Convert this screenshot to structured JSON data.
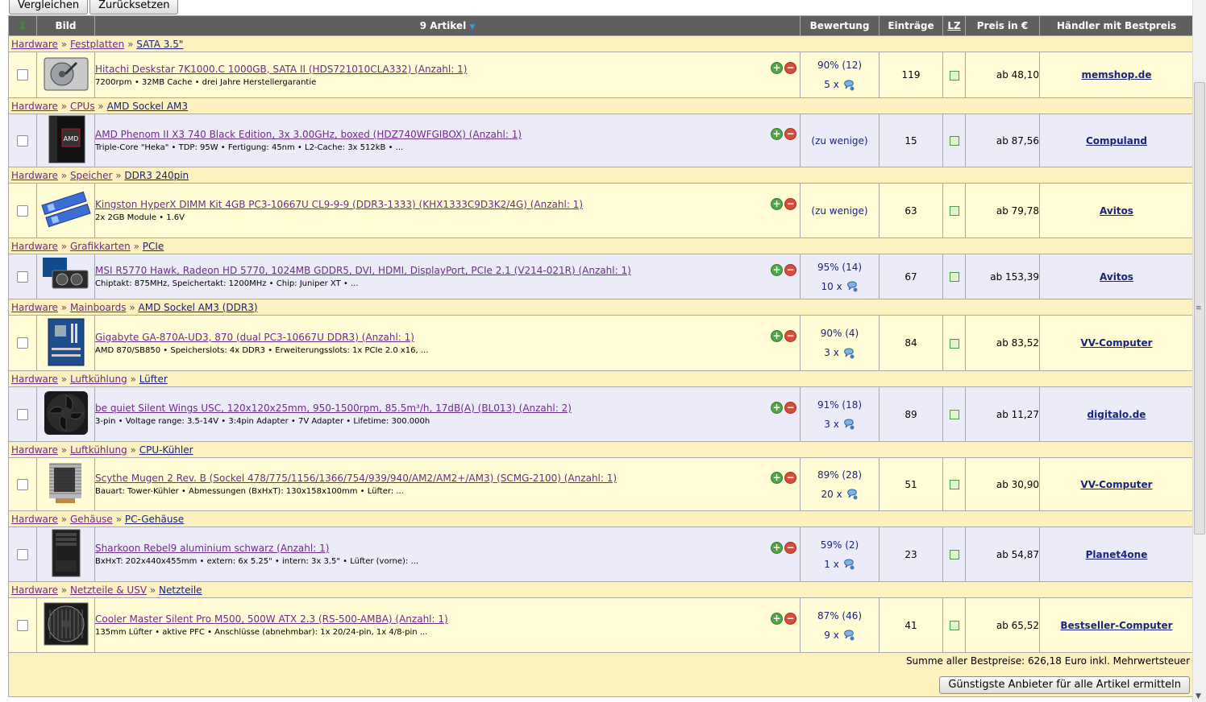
{
  "toolbar": {
    "compare_label": "Vergleichen",
    "reset_label": "Zurücksetzen"
  },
  "header": {
    "sort_icon": "arrow-down-icon",
    "image": "Bild",
    "count": "9 Artikel",
    "rating": "Bewertung",
    "entries": "Einträge",
    "lz": "LZ",
    "price": "Preis in €",
    "dealer": "Händler mit Bestpreis"
  },
  "items": [
    {
      "breadcrumb": [
        "Hardware",
        "Festplatten",
        "SATA 3.5\""
      ],
      "title": "Hitachi Deskstar 7K1000.C 1000GB, SATA II (HDS721010CLA332) (Anzahl: 1)",
      "sub": "7200rpm • 32MB Cache • drei Jahre Herstellergarantie",
      "rating": "90% (12)",
      "comments": "5 x",
      "entries": "119",
      "price": "ab 48,10",
      "dealer": "memshop.de",
      "icon": "hard-drive-icon"
    },
    {
      "breadcrumb": [
        "Hardware",
        "CPUs",
        "AMD Sockel AM3"
      ],
      "title": "AMD Phenom II X3 740 Black Edition, 3x 3.00GHz, boxed (HDZ740WFGIBOX) (Anzahl: 1)",
      "sub": "Triple-Core \"Heka\" • TDP: 95W • Fertigung: 45nm • L2-Cache: 3x 512kB • ...",
      "rating": "(zu wenige)",
      "comments": "",
      "entries": "15",
      "price": "ab 87,56",
      "dealer": "Compuland",
      "icon": "cpu-box-icon"
    },
    {
      "breadcrumb": [
        "Hardware",
        "Speicher",
        "DDR3 240pin"
      ],
      "title": "Kingston HyperX DIMM Kit 4GB PC3-10667U CL9-9-9 (DDR3-1333) (KHX1333C9D3K2/4G) (Anzahl: 1)",
      "sub": "2x 2GB Module • 1.6V",
      "rating": "(zu wenige)",
      "comments": "",
      "entries": "63",
      "price": "ab 79,78",
      "dealer": "Avitos",
      "icon": "ram-icon"
    },
    {
      "breadcrumb": [
        "Hardware",
        "Grafikkarten",
        "PCIe"
      ],
      "title": "MSI R5770 Hawk, Radeon HD 5770, 1024MB GDDR5, DVI, HDMI, DisplayPort, PCIe 2.1 (V214-021R) (Anzahl: 1)",
      "sub": "Chiptakt: 875MHz, Speichertakt: 1200MHz • Chip: Juniper XT • ...",
      "rating": "95% (14)",
      "comments": "10 x",
      "entries": "67",
      "price": "ab 153,39",
      "dealer": "Avitos",
      "icon": "graphics-card-icon"
    },
    {
      "breadcrumb": [
        "Hardware",
        "Mainboards",
        "AMD Sockel AM3 (DDR3)"
      ],
      "title": "Gigabyte GA-870A-UD3, 870 (dual PC3-10667U DDR3) (Anzahl: 1)",
      "sub": "AMD 870/SB850 • Speicherslots: 4x DDR3 • Erweiterungsslots: 1x PCIe 2.0 x16, ...",
      "rating": "90% (4)",
      "comments": "3 x",
      "entries": "84",
      "price": "ab 83,52",
      "dealer": "VV-Computer",
      "icon": "mainboard-icon"
    },
    {
      "breadcrumb": [
        "Hardware",
        "Luftkühlung",
        "Lüfter"
      ],
      "title": "be quiet Silent Wings USC, 120x120x25mm, 950-1500rpm, 85.5m³/h, 17dB(A) (BL013) (Anzahl: 2)",
      "sub": "3-pin • Voltage range: 3.5-14V • 3:4pin Adapter • 7V Adapter • Lifetime: 300.000h",
      "rating": "91% (18)",
      "comments": "3 x",
      "entries": "89",
      "price": "ab 11,27",
      "dealer": "digitalo.de",
      "icon": "fan-icon"
    },
    {
      "breadcrumb": [
        "Hardware",
        "Luftkühlung",
        "CPU-Kühler"
      ],
      "title": "Scythe Mugen 2 Rev. B (Sockel 478/775/1156/1366/754/939/940/AM2/AM2+/AM3) (SCMG-2100) (Anzahl: 1)",
      "sub": "Bauart: Tower-Kühler • Abmessungen (BxHxT): 130x158x100mm • Lüfter: ...",
      "rating": "89% (28)",
      "comments": "20 x",
      "entries": "51",
      "price": "ab 30,90",
      "dealer": "VV-Computer",
      "icon": "cpu-cooler-icon"
    },
    {
      "breadcrumb": [
        "Hardware",
        "Gehäuse",
        "PC-Gehäuse"
      ],
      "title": "Sharkoon Rebel9 aluminium schwarz (Anzahl: 1)",
      "sub": "BxHxT: 202x440x455mm • extern: 6x 5.25\" • intern: 3x 3.5\" • Lüfter (vorne): ...",
      "rating": "59% (2)",
      "comments": "1 x",
      "entries": "23",
      "price": "ab 54,87",
      "dealer": "Planet4one",
      "icon": "pc-case-icon"
    },
    {
      "breadcrumb": [
        "Hardware",
        "Netzteile & USV",
        "Netzteile"
      ],
      "title": "Cooler Master Silent Pro M500, 500W ATX 2.3 (RS-500-AMBA) (Anzahl: 1)",
      "sub": "135mm Lüfter • aktive PFC • Anschlüsse (abnehmbar): 1x 20/24-pin, 1x 4/8-pin ...",
      "rating": "87% (46)",
      "comments": "9 x",
      "entries": "41",
      "price": "ab 65,52",
      "dealer": "Bestseller-Computer",
      "icon": "power-supply-icon"
    }
  ],
  "footer": {
    "sum_text": "Summe aller Bestpreise: 626,18 Euro inkl. Mehrwertsteuer",
    "cheapest_label": "Günstigste Anbieter für alle Artikel ermitteln"
  }
}
